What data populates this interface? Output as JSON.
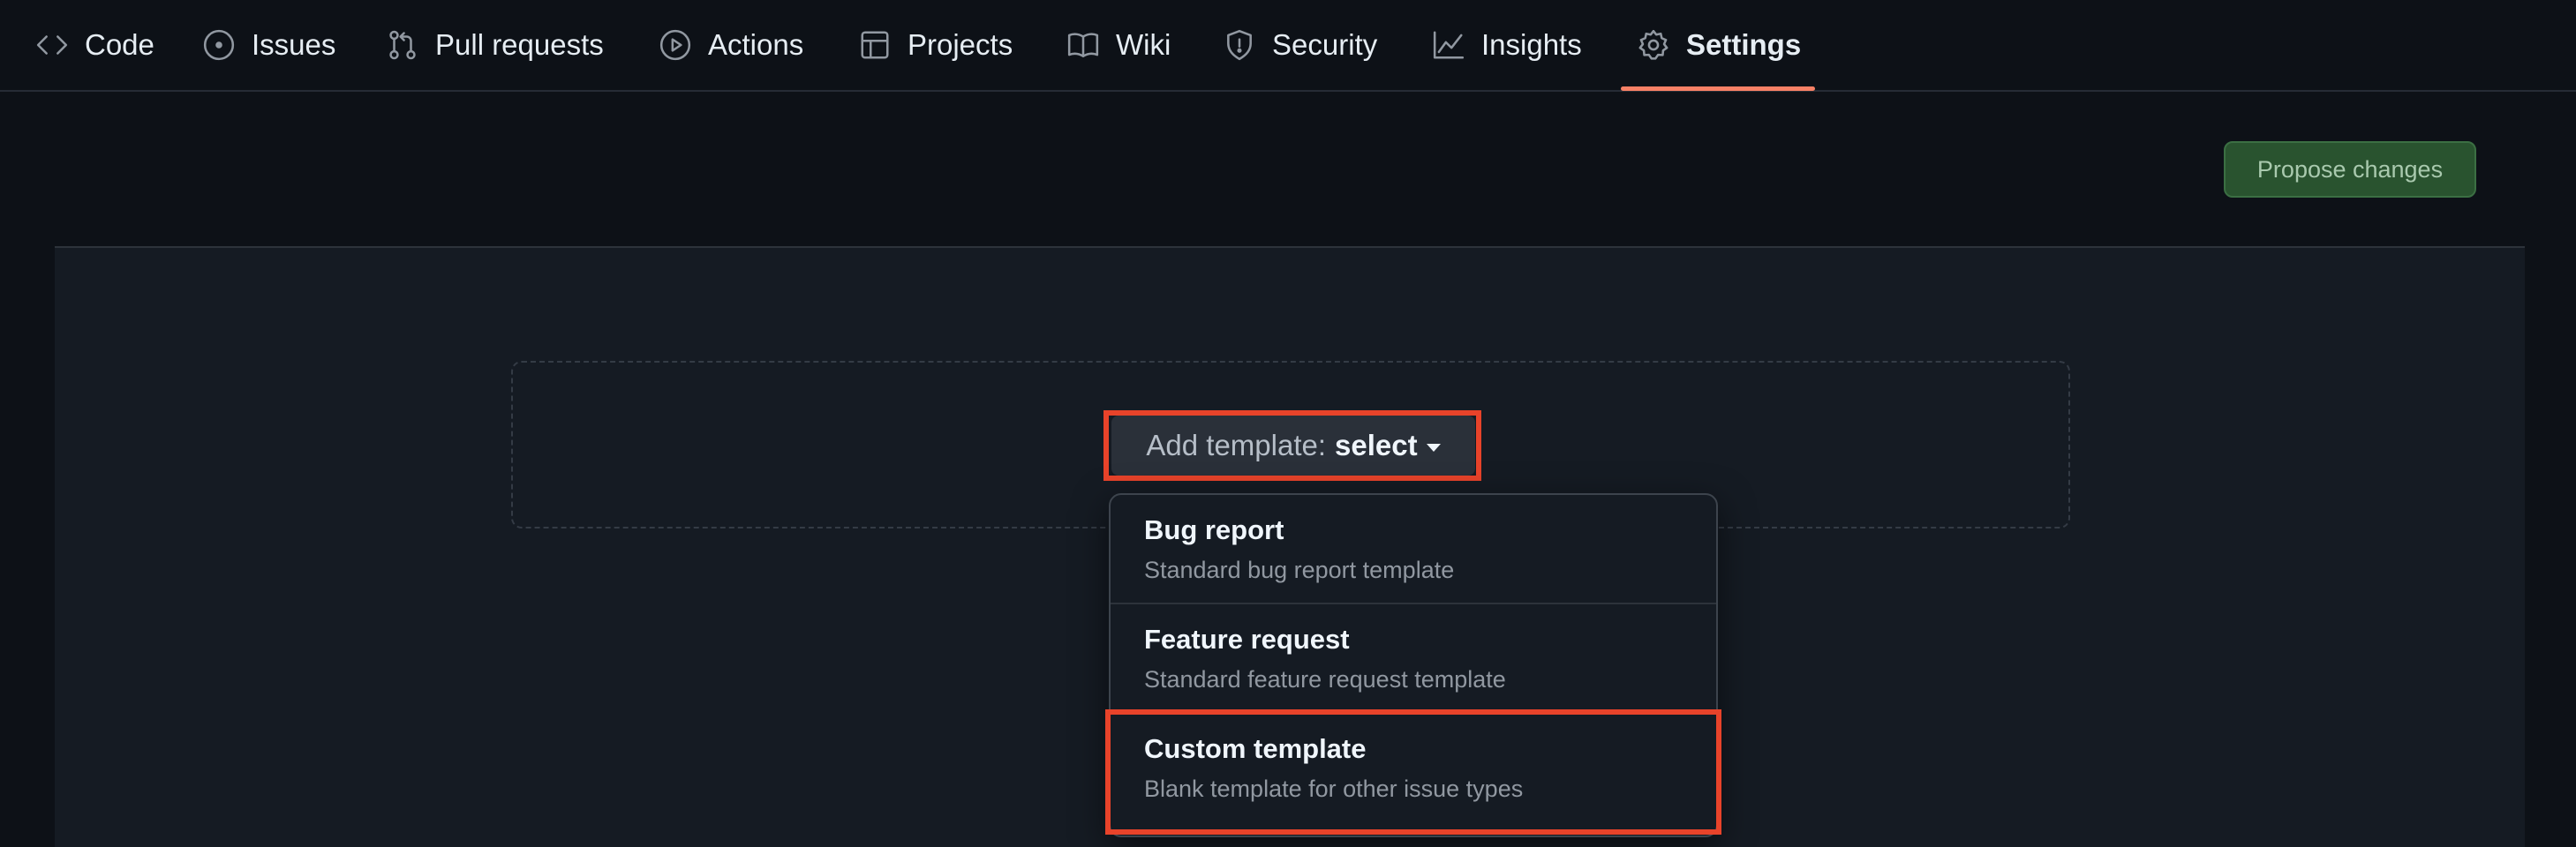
{
  "repo_nav": {
    "tabs": [
      {
        "label": "Code",
        "icon": "code-icon"
      },
      {
        "label": "Issues",
        "icon": "issue-opened-icon"
      },
      {
        "label": "Pull requests",
        "icon": "git-pull-request-icon"
      },
      {
        "label": "Actions",
        "icon": "play-icon"
      },
      {
        "label": "Projects",
        "icon": "table-icon"
      },
      {
        "label": "Wiki",
        "icon": "book-icon"
      },
      {
        "label": "Security",
        "icon": "shield-icon"
      },
      {
        "label": "Insights",
        "icon": "graph-icon"
      },
      {
        "label": "Settings",
        "icon": "gear-icon"
      }
    ],
    "active_tab": "Settings",
    "active_underline_color": "#f78166"
  },
  "actions": {
    "propose_label": "Propose changes"
  },
  "template_select": {
    "prefix": "Add template:",
    "value": "select"
  },
  "template_menu": {
    "items": [
      {
        "title": "Bug report",
        "description": "Standard bug report template"
      },
      {
        "title": "Feature request",
        "description": "Standard feature request template"
      },
      {
        "title": "Custom template",
        "description": "Blank template for other issue types"
      }
    ],
    "highlighted": "Custom template"
  },
  "colors": {
    "background": "#0d1117",
    "panel": "#151b23",
    "accent_button": "#29532f",
    "highlight_outline": "#e8432a"
  }
}
